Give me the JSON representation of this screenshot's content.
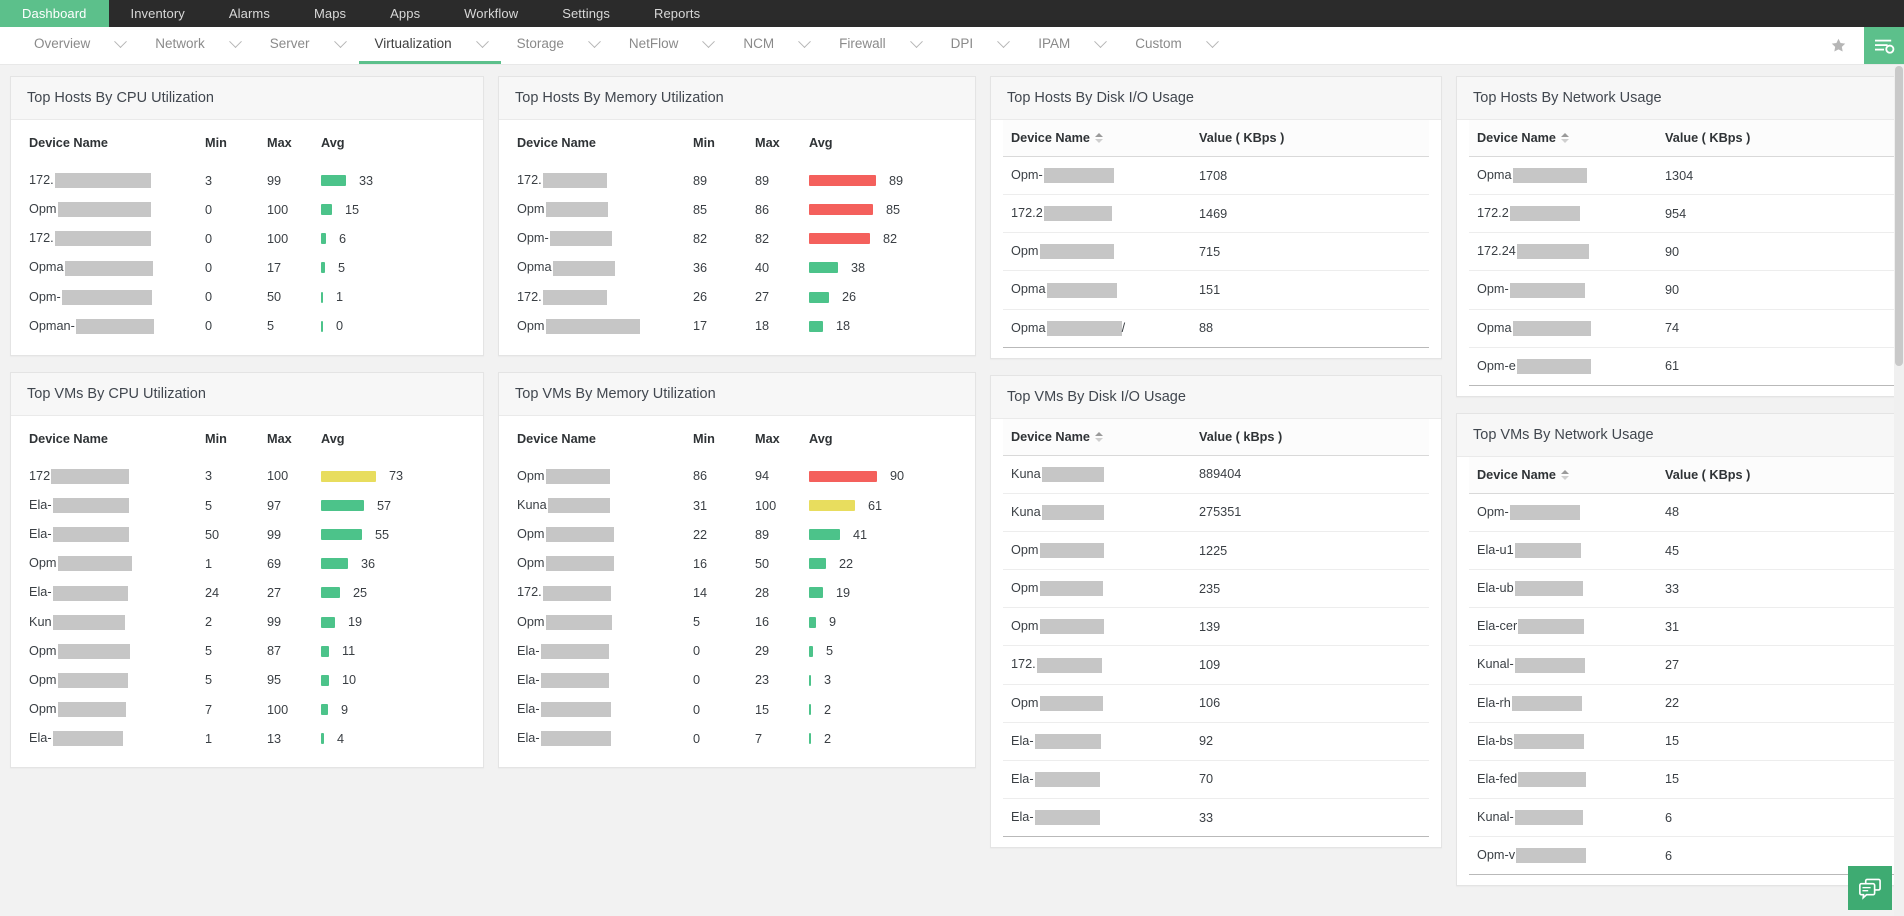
{
  "topnav": {
    "items": [
      {
        "label": "Dashboard",
        "active": true
      },
      {
        "label": "Inventory",
        "active": false
      },
      {
        "label": "Alarms",
        "active": false
      },
      {
        "label": "Maps",
        "active": false
      },
      {
        "label": "Apps",
        "active": false
      },
      {
        "label": "Workflow",
        "active": false
      },
      {
        "label": "Settings",
        "active": false
      },
      {
        "label": "Reports",
        "active": false
      }
    ]
  },
  "subnav": {
    "items": [
      {
        "label": "Overview",
        "active": false
      },
      {
        "label": "Network",
        "active": false
      },
      {
        "label": "Server",
        "active": false
      },
      {
        "label": "Virtualization",
        "active": true
      },
      {
        "label": "Storage",
        "active": false
      },
      {
        "label": "NetFlow",
        "active": false
      },
      {
        "label": "NCM",
        "active": false
      },
      {
        "label": "Firewall",
        "active": false
      },
      {
        "label": "DPI",
        "active": false
      },
      {
        "label": "IPAM",
        "active": false
      },
      {
        "label": "Custom",
        "active": false
      }
    ],
    "star_icon": "star-icon",
    "menu_icon": "menu-search-icon"
  },
  "colors": {
    "accent": "#5cc08b",
    "bar_green": "#4cc38a",
    "bar_yellow": "#e8dd5e",
    "bar_red": "#f4605c",
    "topnav_bg": "#2b2b2b"
  },
  "chat_fab": {
    "icon": "chat-bubbles-icon"
  },
  "cards": {
    "hosts_cpu": {
      "title": "Top Hosts By CPU Utilization",
      "columns": [
        "Device Name",
        "Min",
        "Max",
        "Avg"
      ],
      "rows": [
        {
          "name": "172.",
          "redact_w": 96,
          "min": "3",
          "max": "99",
          "avg": 33,
          "color": "green"
        },
        {
          "name": "Opm",
          "redact_w": 93,
          "min": "0",
          "max": "100",
          "avg": 15,
          "color": "green"
        },
        {
          "name": "172.",
          "redact_w": 96,
          "min": "0",
          "max": "100",
          "avg": 6,
          "color": "green"
        },
        {
          "name": "Opma",
          "redact_w": 88,
          "min": "0",
          "max": "17",
          "avg": 5,
          "color": "green"
        },
        {
          "name": "Opm-",
          "redact_w": 90,
          "min": "0",
          "max": "50",
          "avg": 1,
          "color": "green"
        },
        {
          "name": "Opman-",
          "redact_w": 78,
          "min": "0",
          "max": "5",
          "avg": 0,
          "color": "green"
        }
      ]
    },
    "hosts_memory": {
      "title": "Top Hosts By Memory Utilization",
      "columns": [
        "Device Name",
        "Min",
        "Max",
        "Avg"
      ],
      "rows": [
        {
          "name": "172.",
          "redact_w": 64,
          "min": "89",
          "max": "89",
          "avg": 89,
          "color": "red"
        },
        {
          "name": "Opm",
          "redact_w": 62,
          "min": "85",
          "max": "86",
          "avg": 85,
          "color": "red"
        },
        {
          "name": "Opm-",
          "redact_w": 62,
          "min": "82",
          "max": "82",
          "avg": 82,
          "color": "red"
        },
        {
          "name": "Opma",
          "redact_w": 62,
          "min": "36",
          "max": "40",
          "avg": 38,
          "color": "green"
        },
        {
          "name": "172.",
          "redact_w": 64,
          "min": "26",
          "max": "27",
          "avg": 26,
          "color": "green"
        },
        {
          "name": "Opm",
          "redact_w": 94,
          "min": "17",
          "max": "18",
          "avg": 18,
          "color": "green"
        }
      ]
    },
    "hosts_disk": {
      "title": "Top Hosts By Disk I/O Usage",
      "columns": [
        "Device Name",
        "Value ( KBps )"
      ],
      "rows": [
        {
          "name": "Opm-",
          "redact_w": 70,
          "value": "1708"
        },
        {
          "name": "172.2",
          "redact_w": 68,
          "value": "1469"
        },
        {
          "name": "Opm",
          "redact_w": 74,
          "value": "715"
        },
        {
          "name": "Opma",
          "redact_w": 70,
          "value": "151"
        },
        {
          "name": "Opma",
          "redact_w": 75,
          "value": "88",
          "trail": "/"
        }
      ]
    },
    "hosts_network": {
      "title": "Top Hosts By Network Usage",
      "columns": [
        "Device Name",
        "Value ( KBps )"
      ],
      "rows": [
        {
          "name": "Opma",
          "redact_w": 74,
          "value": "1304"
        },
        {
          "name": "172.2",
          "redact_w": 70,
          "value": "954"
        },
        {
          "name": "172.24",
          "redact_w": 72,
          "value": "90"
        },
        {
          "name": "Opm-",
          "redact_w": 75,
          "value": "90"
        },
        {
          "name": "Opma",
          "redact_w": 78,
          "value": "74"
        },
        {
          "name": "Opm-e",
          "redact_w": 74,
          "value": "61"
        }
      ]
    },
    "vms_cpu": {
      "title": "Top VMs By CPU Utilization",
      "columns": [
        "Device Name",
        "Min",
        "Max",
        "Avg"
      ],
      "rows": [
        {
          "name": "172",
          "redact_w": 78,
          "min": "3",
          "max": "100",
          "avg": 73,
          "color": "yellow"
        },
        {
          "name": "Ela-",
          "redact_w": 76,
          "min": "5",
          "max": "97",
          "avg": 57,
          "color": "green"
        },
        {
          "name": "Ela-",
          "redact_w": 76,
          "min": "50",
          "max": "99",
          "avg": 55,
          "color": "green"
        },
        {
          "name": "Opm",
          "redact_w": 74,
          "min": "1",
          "max": "69",
          "avg": 36,
          "color": "green"
        },
        {
          "name": "Ela-",
          "redact_w": 75,
          "min": "24",
          "max": "27",
          "avg": 25,
          "color": "green"
        },
        {
          "name": "Kun",
          "redact_w": 72,
          "min": "2",
          "max": "99",
          "avg": 19,
          "color": "green"
        },
        {
          "name": "Opm",
          "redact_w": 72,
          "min": "5",
          "max": "87",
          "avg": 11,
          "color": "green"
        },
        {
          "name": "Opm",
          "redact_w": 70,
          "min": "5",
          "max": "95",
          "avg": 10,
          "color": "green"
        },
        {
          "name": "Opm",
          "redact_w": 68,
          "min": "7",
          "max": "100",
          "avg": 9,
          "color": "green"
        },
        {
          "name": "Ela-",
          "redact_w": 70,
          "min": "1",
          "max": "13",
          "avg": 4,
          "color": "green"
        }
      ]
    },
    "vms_memory": {
      "title": "Top VMs By Memory Utilization",
      "columns": [
        "Device Name",
        "Min",
        "Max",
        "Avg"
      ],
      "rows": [
        {
          "name": "Opm",
          "redact_w": 64,
          "min": "86",
          "max": "94",
          "avg": 90,
          "color": "red"
        },
        {
          "name": "Kuna",
          "redact_w": 62,
          "min": "31",
          "max": "100",
          "avg": 61,
          "color": "yellow"
        },
        {
          "name": "Opm",
          "redact_w": 68,
          "min": "22",
          "max": "89",
          "avg": 41,
          "color": "green"
        },
        {
          "name": "Opm",
          "redact_w": 68,
          "min": "16",
          "max": "50",
          "avg": 22,
          "color": "green"
        },
        {
          "name": "172.",
          "redact_w": 68,
          "min": "14",
          "max": "28",
          "avg": 19,
          "color": "green"
        },
        {
          "name": "Opm",
          "redact_w": 66,
          "min": "5",
          "max": "16",
          "avg": 9,
          "color": "green"
        },
        {
          "name": "Ela-",
          "redact_w": 68,
          "min": "0",
          "max": "29",
          "avg": 5,
          "color": "green"
        },
        {
          "name": "Ela-",
          "redact_w": 68,
          "min": "0",
          "max": "23",
          "avg": 3,
          "color": "green"
        },
        {
          "name": "Ela-",
          "redact_w": 70,
          "min": "0",
          "max": "15",
          "avg": 2,
          "color": "green"
        },
        {
          "name": "Ela-",
          "redact_w": 70,
          "min": "0",
          "max": "7",
          "avg": 2,
          "color": "green"
        }
      ]
    },
    "vms_disk": {
      "title": "Top VMs By Disk I/O Usage",
      "columns": [
        "Device Name",
        "Value ( kBps )"
      ],
      "rows": [
        {
          "name": "Kuna",
          "redact_w": 62,
          "value": "889404"
        },
        {
          "name": "Kuna",
          "redact_w": 62,
          "value": "275351"
        },
        {
          "name": "Opm",
          "redact_w": 64,
          "value": "1225"
        },
        {
          "name": "Opm",
          "redact_w": 63,
          "value": "235"
        },
        {
          "name": "Opm",
          "redact_w": 64,
          "value": "139"
        },
        {
          "name": "172.",
          "redact_w": 65,
          "value": "109"
        },
        {
          "name": "Opm",
          "redact_w": 63,
          "value": "106"
        },
        {
          "name": "Ela-",
          "redact_w": 66,
          "value": "92"
        },
        {
          "name": "Ela-",
          "redact_w": 65,
          "value": "70"
        },
        {
          "name": "Ela-",
          "redact_w": 65,
          "value": "33"
        }
      ]
    },
    "vms_network": {
      "title": "Top VMs By Network Usage",
      "columns": [
        "Device Name",
        "Value ( KBps )"
      ],
      "rows": [
        {
          "name": "Opm-",
          "redact_w": 70,
          "value": "48"
        },
        {
          "name": "Ela-u1",
          "redact_w": 66,
          "value": "45"
        },
        {
          "name": "Ela-ub",
          "redact_w": 68,
          "value": "33"
        },
        {
          "name": "Ela-cer",
          "redact_w": 66,
          "value": "31"
        },
        {
          "name": "Kunal-",
          "redact_w": 70,
          "value": "27"
        },
        {
          "name": "Ela-rh",
          "redact_w": 70,
          "value": "22"
        },
        {
          "name": "Ela-bs",
          "redact_w": 70,
          "value": "15"
        },
        {
          "name": "Ela-fed",
          "redact_w": 68,
          "value": "15"
        },
        {
          "name": "Kunal-",
          "redact_w": 68,
          "value": "6"
        },
        {
          "name": "Opm-v",
          "redact_w": 70,
          "value": "6"
        }
      ]
    }
  }
}
